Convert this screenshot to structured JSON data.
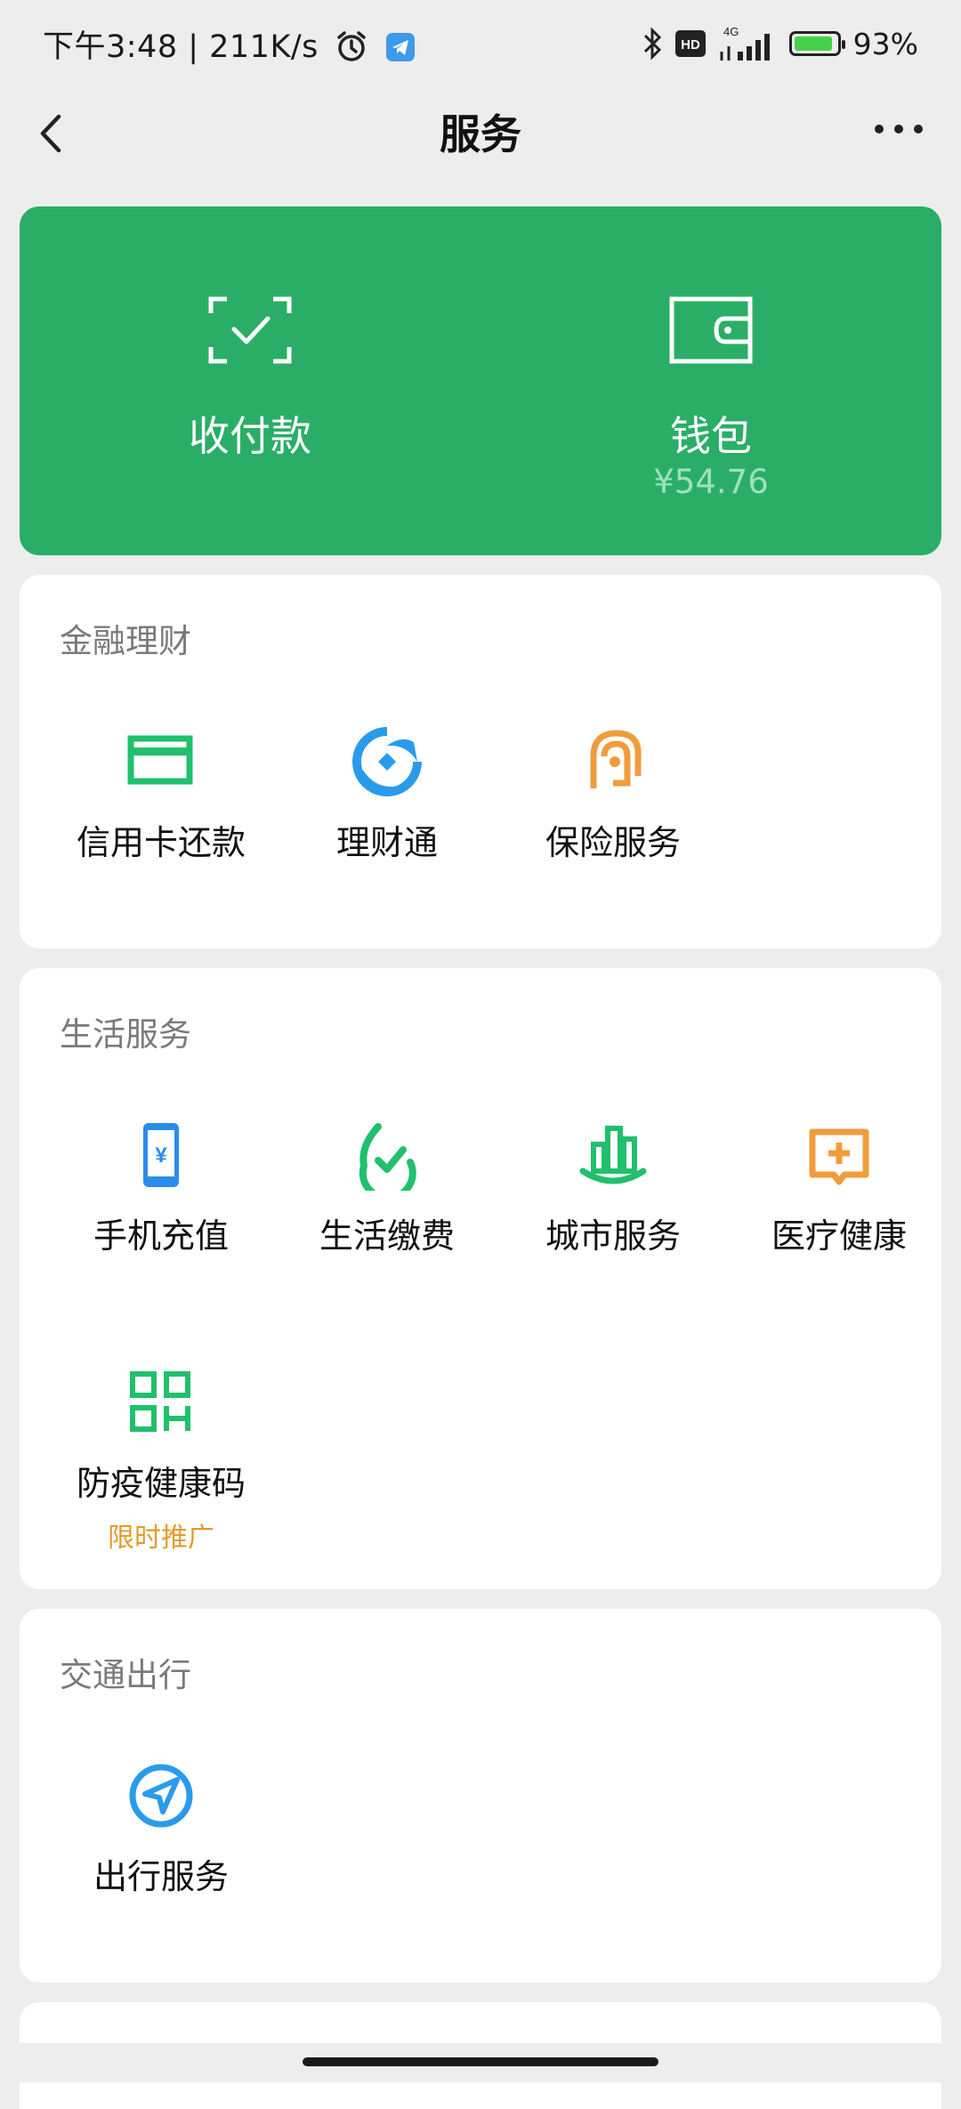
{
  "status": {
    "left_text": "下午3:48 | 211K/s",
    "network": "4G",
    "battery_percent": "93%",
    "battery_level": 0.93,
    "hd_label": "HD"
  },
  "nav": {
    "title": "服务",
    "back_icon": "chevron-left-icon",
    "more_icon": "more-dots-icon"
  },
  "top_card": {
    "background": "#2aae67",
    "pay": {
      "label": "收付款",
      "icon": "scan-pay-icon"
    },
    "wallet": {
      "label": "钱包",
      "balance": "¥54.76",
      "icon": "wallet-icon"
    }
  },
  "sections": [
    {
      "title": "金融理财",
      "items": [
        {
          "label": "信用卡还款",
          "icon": "credit-card-icon",
          "color": "#20c06c"
        },
        {
          "label": "理财通",
          "icon": "licaitong-icon",
          "color": "#2a9bea"
        },
        {
          "label": "保险服务",
          "icon": "insurance-icon",
          "color": "#f19c3b"
        }
      ]
    },
    {
      "title": "生活服务",
      "items": [
        {
          "label": "手机充值",
          "icon": "phone-recharge-icon",
          "color": "#2a8cea"
        },
        {
          "label": "生活缴费",
          "icon": "bill-payment-icon",
          "color": "#20c06c"
        },
        {
          "label": "城市服务",
          "icon": "city-service-icon",
          "color": "#20c06c"
        },
        {
          "label": "医疗健康",
          "icon": "medical-icon",
          "color": "#f19c3b"
        },
        {
          "label": "防疫健康码",
          "tag": "限时推广",
          "icon": "qr-code-icon",
          "color": "#20c06c"
        }
      ]
    },
    {
      "title": "交通出行",
      "items": [
        {
          "label": "出行服务",
          "icon": "navigation-icon",
          "color": "#2a9bea"
        }
      ]
    }
  ]
}
